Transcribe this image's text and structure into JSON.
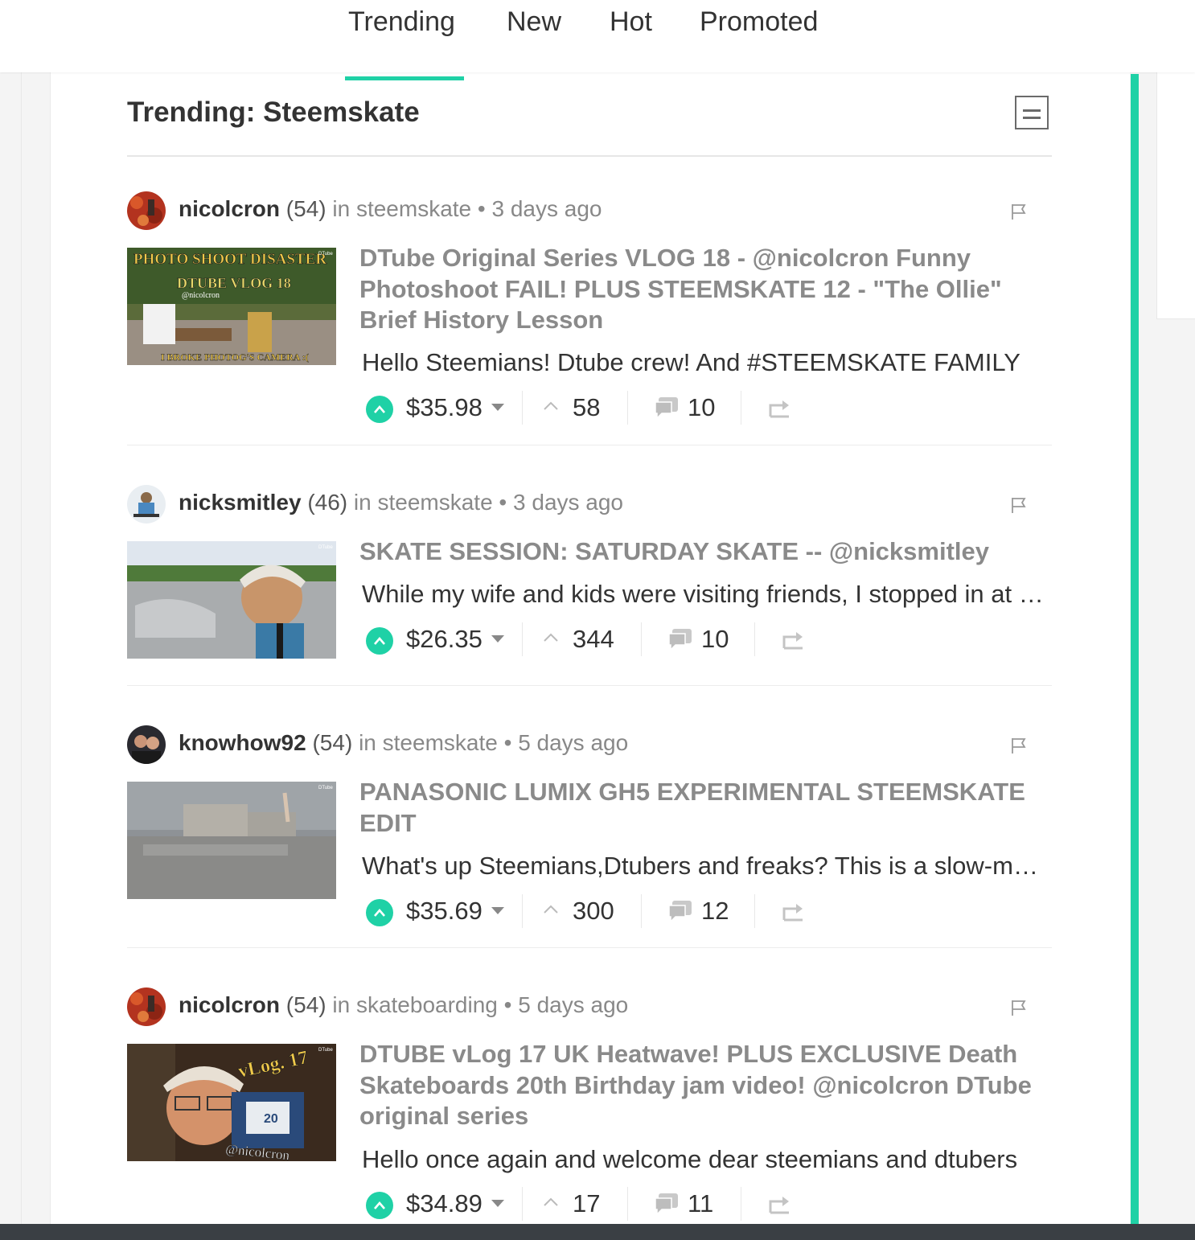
{
  "tabs": [
    {
      "label": "Trending",
      "active": true
    },
    {
      "label": "New",
      "active": false
    },
    {
      "label": "Hot",
      "active": false
    },
    {
      "label": "Promoted",
      "active": false
    }
  ],
  "page_title": "Trending: Steemskate",
  "accent_color": "#1fd1a6",
  "posts": [
    {
      "author": "nicolcron",
      "reputation": "(54)",
      "in_label": "in",
      "category": "steemskate",
      "age": "3 days ago",
      "thumbnail": {
        "lines": [
          "PHOTO SHOOT DISASTER",
          "DTUBE VLOG 18",
          "@nicolcron",
          "I BROKE PHOTOG'S CAMERA :("
        ],
        "badge": "DTube"
      },
      "title": "DTube Original Series VLOG 18 - @nicolcron Funny Photoshoot FAIL! PLUS STEEMSKATE 12 - \"The Ollie\" Brief History Lesson",
      "excerpt": "Hello Steemians! Dtube crew! And #STEEMSKATE FAMILY",
      "payout": "$35.98",
      "votes": "58",
      "comments": "10"
    },
    {
      "author": "nicksmitley",
      "reputation": "(46)",
      "in_label": "in",
      "category": "steemskate",
      "age": "3 days ago",
      "thumbnail": {
        "badge": "DTube"
      },
      "title": "SKATE SESSION: SATURDAY SKATE -- @nicksmitley",
      "excerpt": "While my wife and kids were visiting friends, I stopped in at the skatepark",
      "payout": "$26.35",
      "votes": "344",
      "comments": "10"
    },
    {
      "author": "knowhow92",
      "reputation": "(54)",
      "in_label": "in",
      "category": "steemskate",
      "age": "5 days ago",
      "thumbnail": {
        "badge": "DTube"
      },
      "title": "PANASONIC LUMIX GH5 EXPERIMENTAL STEEMSKATE EDIT",
      "excerpt": "What's up Steemians,Dtubers and freaks? This is a slow-motion edit",
      "payout": "$35.69",
      "votes": "300",
      "comments": "12"
    },
    {
      "author": "nicolcron",
      "reputation": "(54)",
      "in_label": "in",
      "category": "skateboarding",
      "age": "5 days ago",
      "thumbnail": {
        "lines": [
          "vLog. 17",
          "20",
          "@nicolcron"
        ],
        "badge": "DTube"
      },
      "title": "DTUBE vLog 17 UK Heatwave! PLUS EXCLUSIVE Death Skateboards 20th Birthday jam video! @nicolcron DTube original series",
      "excerpt": "Hello once again and welcome dear steemians and dtubers",
      "payout": "$34.89",
      "votes": "17",
      "comments": "11"
    }
  ]
}
